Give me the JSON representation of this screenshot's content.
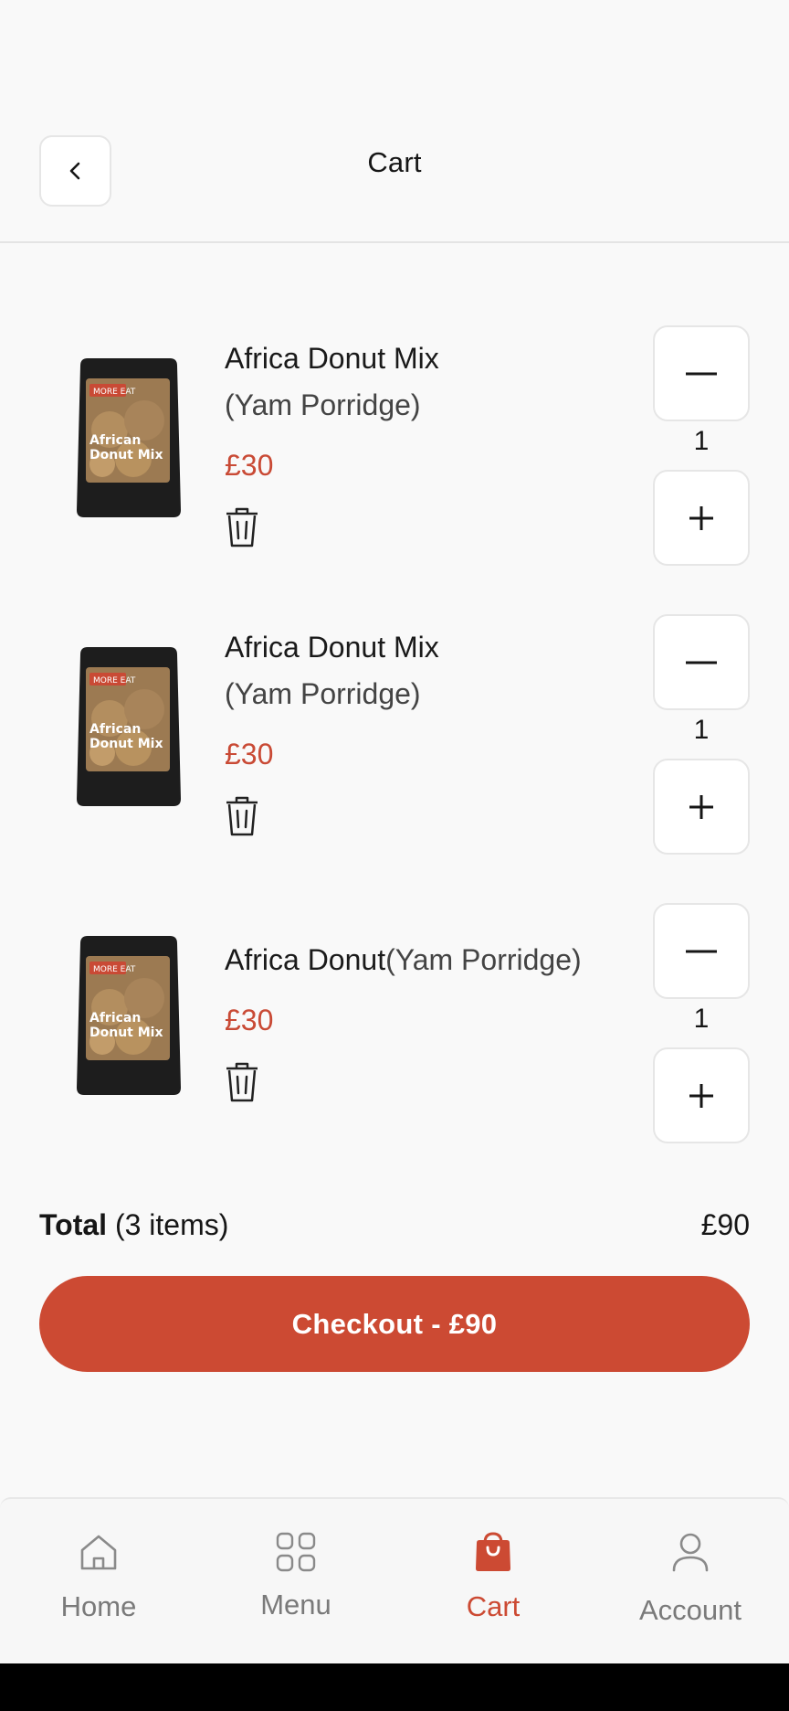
{
  "header": {
    "title": "Cart",
    "back_icon": "chevron-left-icon"
  },
  "cart": {
    "items": [
      {
        "name": "Africa Donut Mix",
        "variant": "(Yam Porridge)",
        "price": "£30",
        "quantity": "1",
        "image_label": "African Donut Mix"
      },
      {
        "name": "Africa Donut Mix",
        "variant": "(Yam Porridge)",
        "price": "£30",
        "quantity": "1",
        "image_label": "African Donut Mix"
      },
      {
        "name": "Africa Donut",
        "variant": "(Yam Porridge)",
        "price": "£30",
        "quantity": "1",
        "image_label": "African Donut Mix"
      }
    ]
  },
  "summary": {
    "total_label": "Total",
    "total_count": "(3 items)",
    "total_value": "£90"
  },
  "checkout": {
    "label": "Checkout - £90"
  },
  "nav": {
    "items": [
      {
        "label": "Home",
        "icon": "home-icon",
        "active": false
      },
      {
        "label": "Menu",
        "icon": "grid-icon",
        "active": false
      },
      {
        "label": "Cart",
        "icon": "shopping-bag-icon",
        "active": true
      },
      {
        "label": "Account",
        "icon": "user-icon",
        "active": false
      }
    ]
  },
  "colors": {
    "accent": "#cc4a33",
    "price": "#c94a35",
    "background": "#f9f9f9",
    "inactive_nav": "#7a7a7a"
  }
}
